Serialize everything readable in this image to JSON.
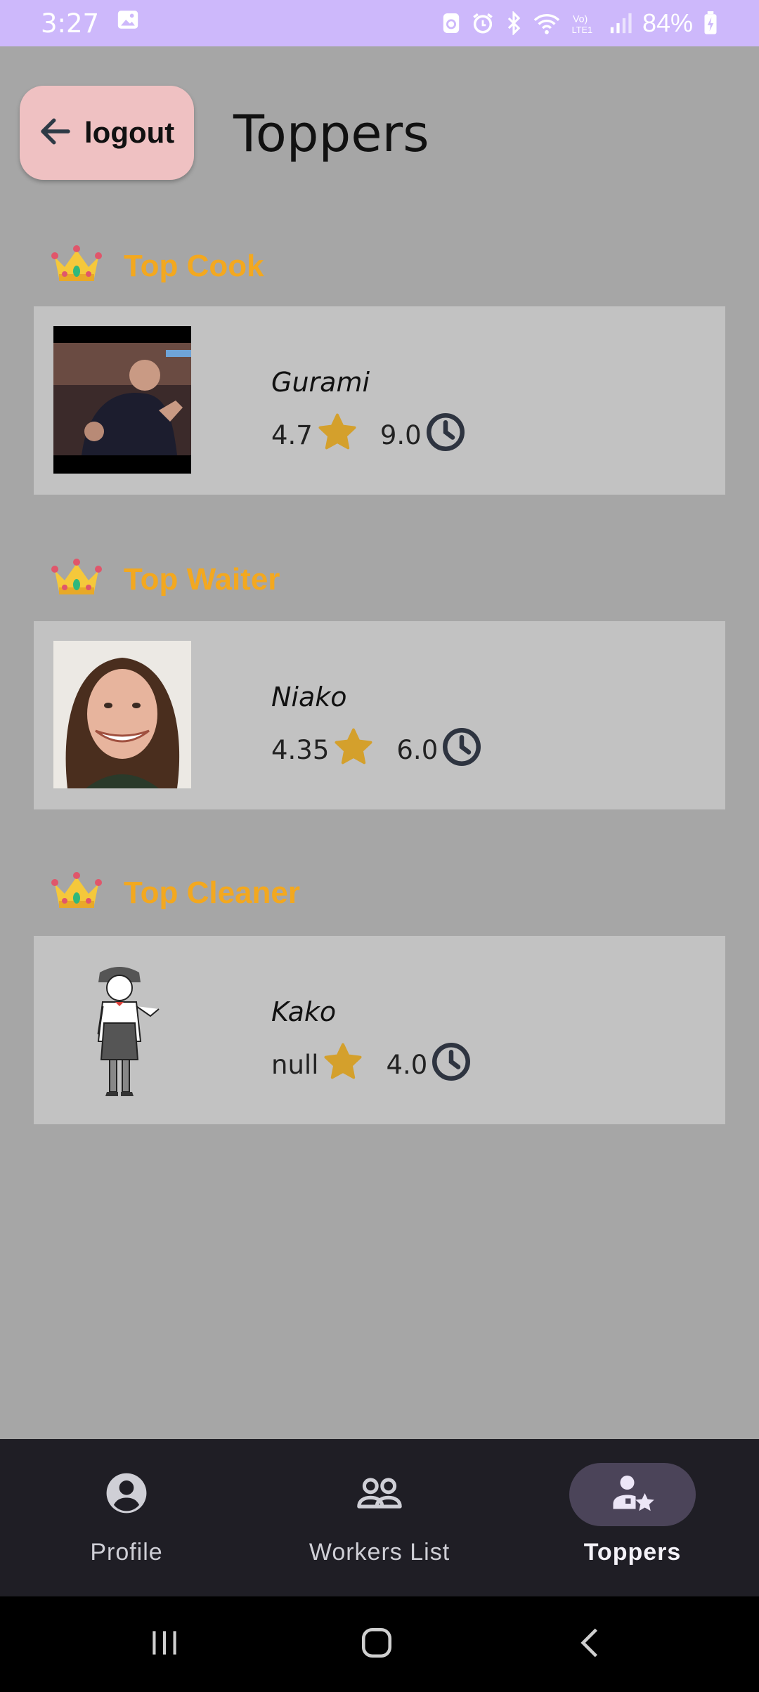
{
  "status_bar": {
    "time": "3:27",
    "battery": "84%"
  },
  "header": {
    "back_label": "logout",
    "title": "Toppers"
  },
  "sections": [
    {
      "title": "Top Cook",
      "name": "Gurami",
      "rating": "4.7",
      "hours": "9.0"
    },
    {
      "title": "Top Waiter",
      "name": "Niako",
      "rating": "4.35",
      "hours": "6.0"
    },
    {
      "title": "Top Cleaner",
      "name": "Kako",
      "rating": "null",
      "hours": "4.0"
    }
  ],
  "bottom_nav": {
    "items": [
      {
        "label": "Profile",
        "icon": "account-circle-icon"
      },
      {
        "label": "Workers List",
        "icon": "group-icon"
      },
      {
        "label": "Toppers",
        "icon": "person-star-icon",
        "active": true
      }
    ]
  },
  "colors": {
    "section_title": "#f3a81f",
    "star": "#d4a02c",
    "card": "#c2c2c2",
    "background": "#a6a6a6"
  }
}
